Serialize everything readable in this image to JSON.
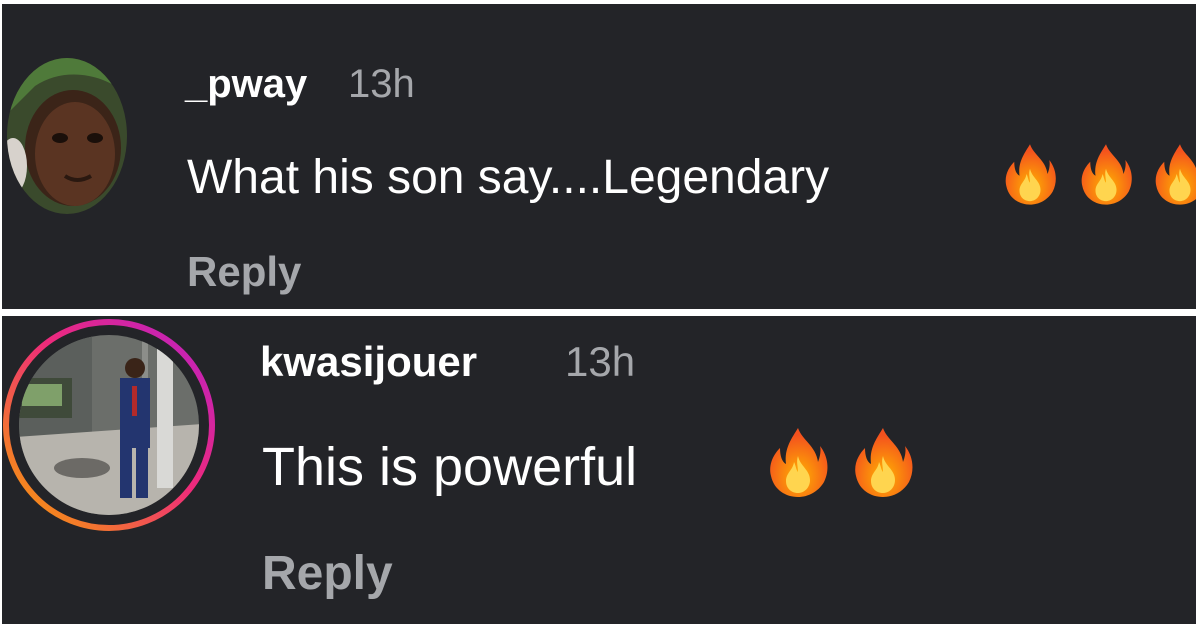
{
  "comments": [
    {
      "username": "_pway",
      "time": "13h",
      "text": "What his son say....Legendary",
      "emoji": [
        "fire-icon",
        "fire-icon",
        "fire-icon"
      ],
      "reply_label": "Reply",
      "avatar": "profile-photo"
    },
    {
      "username": "kwasijouer",
      "time": "13h",
      "text": "This is powerful",
      "emoji": [
        "fire-icon",
        "fire-icon"
      ],
      "reply_label": "Reply",
      "avatar": "profile-photo-with-story-ring"
    }
  ],
  "colors": {
    "background": "#232428",
    "text": "#ffffff",
    "muted": "#a5a7ab",
    "story_ring_start": "#f7a400",
    "story_ring_end": "#c71fb5"
  }
}
